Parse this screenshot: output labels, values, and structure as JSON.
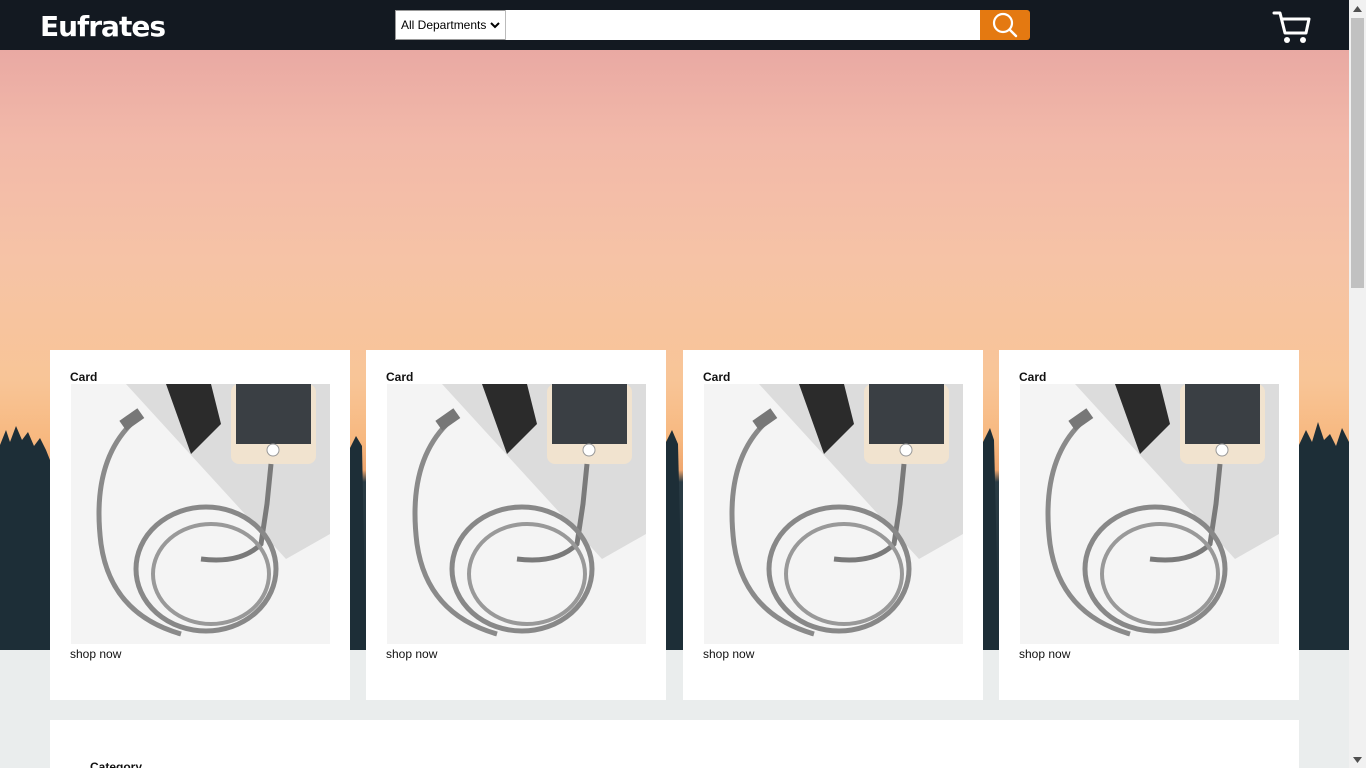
{
  "header": {
    "logo": "Eufrates",
    "department_select": "All Departments",
    "search_placeholder": "",
    "colors": {
      "bar": "#131921",
      "search_button": "#e47911"
    },
    "icons": {
      "search": "search-icon",
      "cart": "cart-icon",
      "dropdown": "chevron-down-icon"
    }
  },
  "cards": [
    {
      "title": "Card",
      "link": "shop now",
      "image": "usb-cable-with-phone"
    },
    {
      "title": "Card",
      "link": "shop now",
      "image": "usb-cable-with-phone"
    },
    {
      "title": "Card",
      "link": "shop now",
      "image": "usb-cable-with-phone"
    },
    {
      "title": "Card",
      "link": "shop now",
      "image": "usb-cable-with-phone"
    }
  ],
  "category": {
    "title": "Category"
  }
}
